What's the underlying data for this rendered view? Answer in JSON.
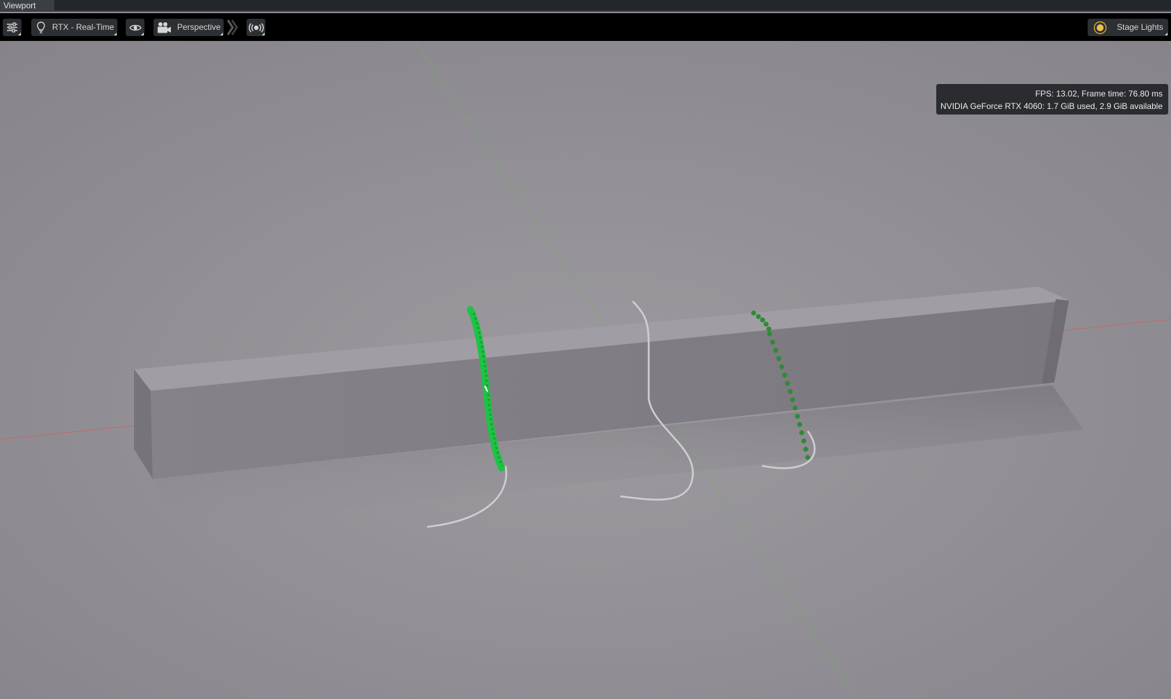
{
  "window": {
    "tab_label": "Viewport"
  },
  "toolbar": {
    "settings_icon": "sliders-icon",
    "renderer_icon": "lightbulb-icon",
    "renderer_label": "RTX - Real-Time",
    "visibility_icon": "eye-icon",
    "camera_icon": "camera-icon",
    "camera_label": "Perspective",
    "more_icon": "chevron-right-icon",
    "broadcast_icon": "broadcast-icon",
    "lighting_icon": "sun-icon",
    "lighting_label": "Stage Lights"
  },
  "stats": {
    "fps_line": "FPS: 13.02, Frame time: 76.80 ms",
    "gpu_line": "NVIDIA GeForce RTX 4060: 1.7 GiB used, 2.9 GiB available"
  },
  "colors": {
    "toolbar_bg": "#000000",
    "button_bg": "#2c2f33",
    "floor": "#8f8d92",
    "x_axis": "#c2696a",
    "z_axis": "#78a66e",
    "beam": "#838187",
    "particles": "#1fc244",
    "particles_dark": "#2f8a37",
    "rope": "#c9c8cc"
  }
}
